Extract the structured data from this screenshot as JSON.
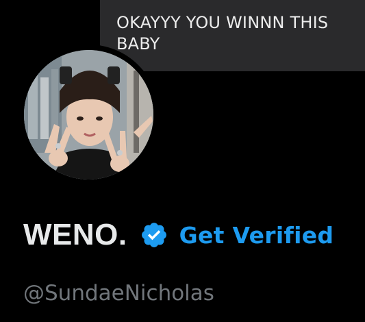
{
  "banner": {
    "message_text": "OKAYYY YOU WINNN THIS\nBABY"
  },
  "profile": {
    "display_name": "WENO.",
    "handle": "@SundaeNicholas",
    "get_verified_label": "Get Verified",
    "verified_icon": "verified-badge-icon"
  },
  "colors": {
    "background": "#000000",
    "bubble": "#2a2a2c",
    "name": "#e7e9ea",
    "accent": "#1d9bf0",
    "handle": "#71767b"
  }
}
